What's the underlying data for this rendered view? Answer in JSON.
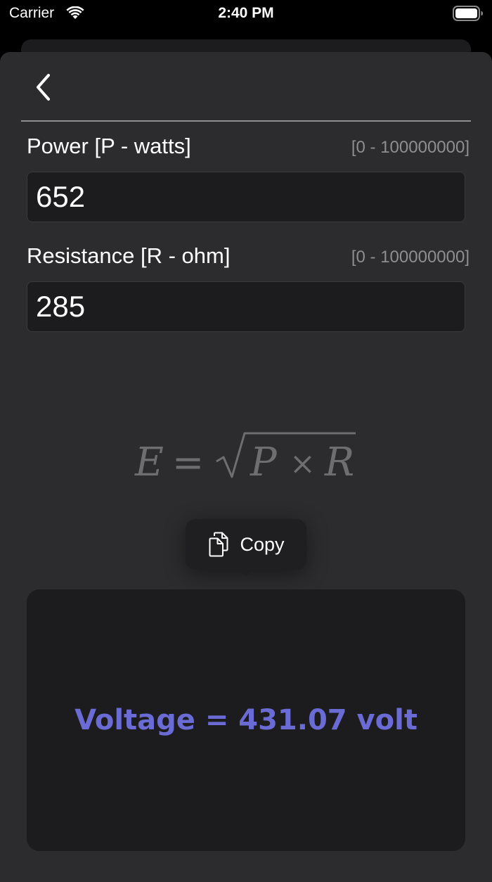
{
  "status_bar": {
    "carrier": "Carrier",
    "time": "2:40 PM"
  },
  "nav": {
    "back_icon": "chevron-left-icon"
  },
  "fields": {
    "power": {
      "label": "Power [P - watts]",
      "range": "[0 - 100000000]",
      "value": "652"
    },
    "resistance": {
      "label": "Resistance [R - ohm]",
      "range": "[0 - 100000000]",
      "value": "285"
    }
  },
  "formula": {
    "lhs": "E",
    "equals": "=",
    "p": "P",
    "times": "×",
    "r": "R"
  },
  "copy_menu": {
    "icon": "copy-documents-icon",
    "label": "Copy"
  },
  "result": {
    "text": "Voltage = 431.07 volt"
  },
  "colors": {
    "background": "#000000",
    "sheet": "#2c2c2e",
    "input_bg": "#1c1c1e",
    "secondary_text": "#8e8e93",
    "formula_text": "#6e6e70",
    "result_accent": "#6b6bd6"
  }
}
